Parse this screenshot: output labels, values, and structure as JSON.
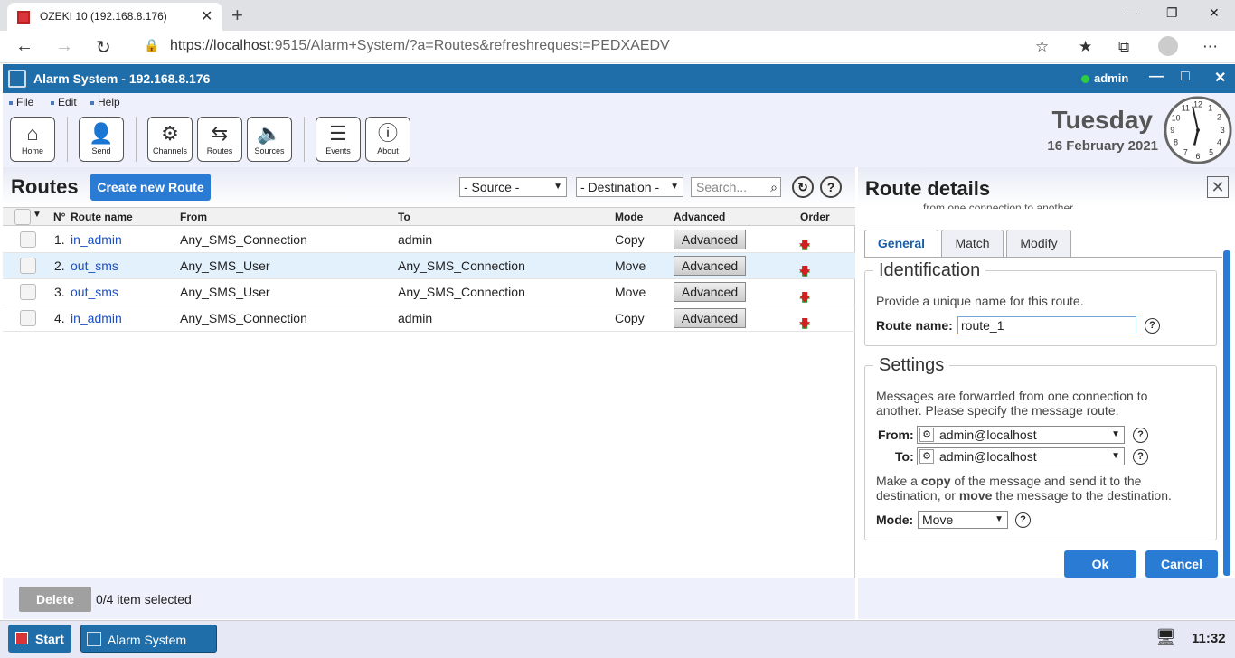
{
  "browser": {
    "tab_title": "OZEKI 10 (192.168.8.176)",
    "url_host": "https://localhost",
    "url_rest": ":9515/Alarm+System/?a=Routes&refreshrequest=PEDXAEDV"
  },
  "app": {
    "title": "Alarm System - 192.168.8.176",
    "user": "admin",
    "menu": [
      "File",
      "Edit",
      "Help"
    ],
    "toolbar": [
      "Home",
      "Send",
      "Channels",
      "Routes",
      "Sources",
      "Events",
      "About"
    ],
    "day": "Tuesday",
    "date": "16 February 2021"
  },
  "routes": {
    "title": "Routes",
    "create_label": "Create new Route",
    "source_filter": "- Source -",
    "destination_filter": "- Destination -",
    "search_placeholder": "Search...",
    "columns": {
      "no": "N°",
      "name": "Route name",
      "from": "From",
      "to": "To",
      "mode": "Mode",
      "advanced": "Advanced",
      "order": "Order"
    },
    "rows": [
      {
        "no": "1.",
        "name": "in_admin",
        "from": "Any_SMS_Connection",
        "to": "admin",
        "mode": "Copy",
        "advanced": "Advanced"
      },
      {
        "no": "2.",
        "name": "out_sms",
        "from": "Any_SMS_User",
        "to": "Any_SMS_Connection",
        "mode": "Move",
        "advanced": "Advanced"
      },
      {
        "no": "3.",
        "name": "out_sms",
        "from": "Any_SMS_User",
        "to": "Any_SMS_Connection",
        "mode": "Move",
        "advanced": "Advanced"
      },
      {
        "no": "4.",
        "name": "in_admin",
        "from": "Any_SMS_Connection",
        "to": "admin",
        "mode": "Copy",
        "advanced": "Advanced"
      }
    ],
    "delete_label": "Delete",
    "selection_info": "0/4 item selected"
  },
  "details": {
    "title": "Route details",
    "top_text": "from one connection to another.",
    "tabs": [
      "General",
      "Match",
      "Modify"
    ],
    "identification": {
      "legend": "Identification",
      "hint": "Provide a unique name for this route.",
      "name_label": "Route name:",
      "name_value": "route_1"
    },
    "settings": {
      "legend": "Settings",
      "hint": "Messages are forwarded from one connection to another. Please specify the message route.",
      "from_label": "From:",
      "from_value": "admin@localhost",
      "to_label": "To:",
      "to_value": "admin@localhost",
      "mode_hint_a": "Make a ",
      "mode_hint_b": "copy",
      "mode_hint_c": " of the message and send it to the destination, or ",
      "mode_hint_d": "move",
      "mode_hint_e": " the message to the destination.",
      "mode_label": "Mode:",
      "mode_value": "Move"
    },
    "ok_label": "Ok",
    "cancel_label": "Cancel"
  },
  "taskbar": {
    "start_label": "Start",
    "app_label": "Alarm System",
    "time": "11:32"
  }
}
